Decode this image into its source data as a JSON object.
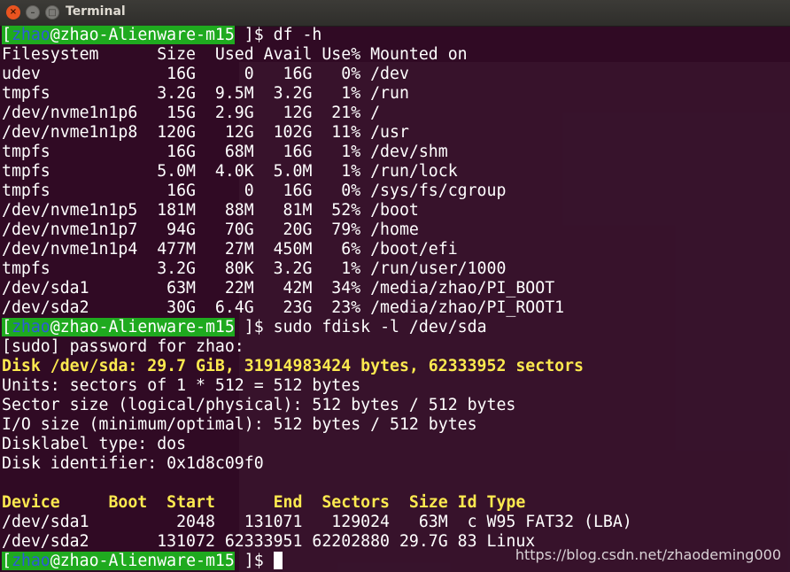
{
  "window": {
    "title": "Terminal",
    "close_glyph": "×",
    "min_glyph": "–",
    "max_glyph": "□"
  },
  "prompt": {
    "user": "zhao",
    "host": "@zhao-Alienware-m15",
    "suffix": " ]$ "
  },
  "commands": {
    "df": "df -h",
    "fdisk": "sudo fdisk -l /dev/sda",
    "empty": ""
  },
  "df_output": [
    "Filesystem      Size  Used Avail Use% Mounted on",
    "udev             16G     0   16G   0% /dev",
    "tmpfs           3.2G  9.5M  3.2G   1% /run",
    "/dev/nvme1n1p6   15G  2.9G   12G  21% /",
    "/dev/nvme1n1p8  120G   12G  102G  11% /usr",
    "tmpfs            16G   68M   16G   1% /dev/shm",
    "tmpfs           5.0M  4.0K  5.0M   1% /run/lock",
    "tmpfs            16G     0   16G   0% /sys/fs/cgroup",
    "/dev/nvme1n1p5  181M   88M   81M  52% /boot",
    "/dev/nvme1n1p7   94G   70G   20G  79% /home",
    "/dev/nvme1n1p4  477M   27M  450M   6% /boot/efi",
    "tmpfs           3.2G   80K  3.2G   1% /run/user/1000",
    "/dev/sda1        63M   22M   42M  34% /media/zhao/PI_BOOT",
    "/dev/sda2        30G  6.4G   23G  23% /media/zhao/PI_ROOT1"
  ],
  "fdisk_output": {
    "password": "[sudo] password for zhao:",
    "disk": "Disk /dev/sda: 29.7 GiB, 31914983424 bytes, 62333952 sectors",
    "info": [
      "Units: sectors of 1 * 512 = 512 bytes",
      "Sector size (logical/physical): 512 bytes / 512 bytes",
      "I/O size (minimum/optimal): 512 bytes / 512 bytes",
      "Disklabel type: dos",
      "Disk identifier: 0x1d8c09f0"
    ],
    "table_header": "Device     Boot  Start      End  Sectors  Size Id Type",
    "table_rows": [
      "/dev/sda1         2048   131071   129024   63M  c W95 FAT32 (LBA)",
      "/dev/sda2       131072 62333951 62202880 29.7G 83 Linux"
    ]
  },
  "watermark": "https://blog.csdn.net/zhaodeming000",
  "colors": {
    "background": "#300a24",
    "prompt_bg": "#1faa1f",
    "prompt_user": "#2e5bd8",
    "highlight": "#fce94f",
    "text": "#ffffff"
  }
}
